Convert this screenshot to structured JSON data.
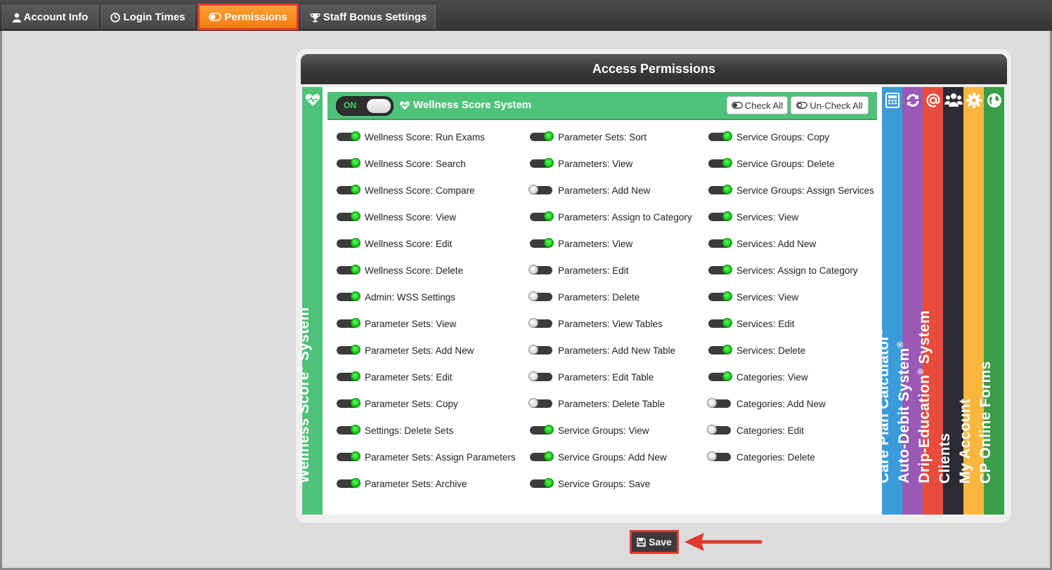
{
  "tabs": [
    {
      "label": "Account Info",
      "icon": "user-icon"
    },
    {
      "label": "Login Times",
      "icon": "clock-icon"
    },
    {
      "label": "Permissions",
      "icon": "toggle-icon",
      "active": true
    },
    {
      "label": "Staff Bonus Settings",
      "icon": "trophy-icon"
    }
  ],
  "card": {
    "title": "Access Permissions"
  },
  "section": {
    "switch_label": "ON",
    "title": "Wellness Score System",
    "check_all": "Check All",
    "uncheck_all": "Un-Check All"
  },
  "side_strips": {
    "left": {
      "label": "Wellness Score",
      "reg": "®",
      "label2": " System",
      "color": "#4fc27a"
    },
    "right": [
      {
        "label": "Care Plan Calculator",
        "reg": "®",
        "label2": "",
        "color": "#3a9bd9",
        "icon": "calculator-icon"
      },
      {
        "label": "Auto-Debit System",
        "reg": "®",
        "label2": "",
        "color": "#9b59b6",
        "icon": "refresh-icon"
      },
      {
        "label": "Drip-Education",
        "reg": "®",
        "label2": " System",
        "color": "#e74c3c",
        "icon": "at-icon"
      },
      {
        "label": "Clients",
        "reg": "",
        "label2": "",
        "color": "#2b2b34",
        "icon": "users-icon"
      },
      {
        "label": "My Account",
        "reg": "",
        "label2": "",
        "color": "#fbb73d",
        "icon": "gear-icon"
      },
      {
        "label": "CP Online Forms",
        "reg": "",
        "label2": "",
        "color": "#3a9e48",
        "icon": "globe-icon"
      }
    ]
  },
  "permissions": {
    "col1": [
      {
        "label": "Wellness Score: Run Exams",
        "on": true
      },
      {
        "label": "Wellness Score: Search",
        "on": true
      },
      {
        "label": "Wellness Score: Compare",
        "on": true
      },
      {
        "label": "Wellness Score: View",
        "on": true
      },
      {
        "label": "Wellness Score: Edit",
        "on": true
      },
      {
        "label": "Wellness Score: Delete",
        "on": true
      },
      {
        "label": "Admin: WSS Settings",
        "on": true
      },
      {
        "label": "Parameter Sets: View",
        "on": true
      },
      {
        "label": "Parameter Sets: Add New",
        "on": true
      },
      {
        "label": "Parameter Sets: Edit",
        "on": true
      },
      {
        "label": "Parameter Sets: Copy",
        "on": true
      },
      {
        "label": "Settings: Delete Sets",
        "on": true
      },
      {
        "label": "Parameter Sets: Assign Parameters",
        "on": true
      },
      {
        "label": "Parameter Sets: Archive",
        "on": true
      }
    ],
    "col2": [
      {
        "label": "Parameter Sets: Sort",
        "on": true
      },
      {
        "label": "Parameters: View",
        "on": true
      },
      {
        "label": "Parameters: Add New",
        "on": false
      },
      {
        "label": "Parameters: Assign to Category",
        "on": true
      },
      {
        "label": "Parameters: View",
        "on": true
      },
      {
        "label": "Parameters: Edit",
        "on": false
      },
      {
        "label": "Parameters: Delete",
        "on": false
      },
      {
        "label": "Parameters: View Tables",
        "on": false
      },
      {
        "label": "Parameters: Add New Table",
        "on": false
      },
      {
        "label": "Parameters: Edit Table",
        "on": false
      },
      {
        "label": "Parameters: Delete Table",
        "on": false
      },
      {
        "label": "Service Groups: View",
        "on": true
      },
      {
        "label": "Service Groups: Add New",
        "on": true
      },
      {
        "label": "Service Groups: Save",
        "on": true
      }
    ],
    "col3": [
      {
        "label": "Service Groups: Copy",
        "on": true
      },
      {
        "label": "Service Groups: Delete",
        "on": true
      },
      {
        "label": "Service Groups: Assign Services",
        "on": true
      },
      {
        "label": "Services: View",
        "on": true
      },
      {
        "label": "Services: Add New",
        "on": true
      },
      {
        "label": "Services: Assign to Category",
        "on": true
      },
      {
        "label": "Services: View",
        "on": true
      },
      {
        "label": "Services: Edit",
        "on": true
      },
      {
        "label": "Services: Delete",
        "on": true
      },
      {
        "label": "Categories: View",
        "on": true
      },
      {
        "label": "Categories: Add New",
        "on": false
      },
      {
        "label": "Categories: Edit",
        "on": false
      },
      {
        "label": "Categories: Delete",
        "on": false
      }
    ]
  },
  "save": {
    "label": "Save"
  },
  "colors": {
    "accent": "#f47d12",
    "highlight": "#e03a2e",
    "green": "#4fc27a"
  }
}
